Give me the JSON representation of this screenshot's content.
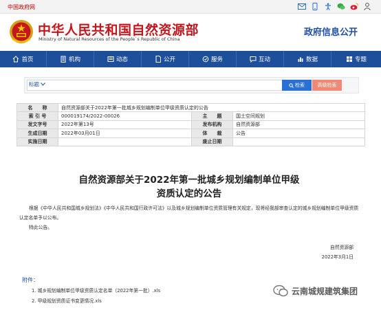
{
  "topbar": {
    "gov_link": "中国政府网",
    "icons": [
      "envelope-icon",
      "mobile-icon",
      "accessibility-icon",
      "wechat-icon",
      "weibo-icon",
      "user-icon"
    ]
  },
  "header": {
    "ministry_cn": "中华人民共和国自然资源部",
    "ministry_en": "Ministry of Natural Resources of the People`s Republic of China",
    "gov_info": "政府信息公开"
  },
  "nav": {
    "items": [
      {
        "label": "首页",
        "icon": "home-icon"
      },
      {
        "label": "机构",
        "icon": "building-icon"
      },
      {
        "label": "动态",
        "icon": "news-icon"
      },
      {
        "label": "公开",
        "icon": "document-icon"
      },
      {
        "label": "服务",
        "icon": "service-icon"
      },
      {
        "label": "互动",
        "icon": "chat-icon"
      },
      {
        "label": "数据",
        "icon": "chart-icon"
      },
      {
        "label": "专题",
        "icon": "topic-icon"
      }
    ]
  },
  "search": {
    "select_value": "标题",
    "search_label": "检索",
    "advanced_label": "高级检索"
  },
  "meta": {
    "rows": [
      {
        "label": "名　　称",
        "value": "自然资源部关于2022年第一批城乡规划编制单位甲级资质认定的公告"
      },
      {
        "label": "索 引 号",
        "value": "000019174/2022-00026",
        "label2": "主　　题",
        "value2": "国土空间规划"
      },
      {
        "label": "发文字号",
        "value": "2022年第13号",
        "label2": "发布机构",
        "value2": "自然资源部"
      },
      {
        "label": "生成日期",
        "value": "2022年03月01日",
        "label2": "体　　裁",
        "value2": "公告"
      },
      {
        "label": "实施日期",
        "value": "",
        "label2": "废止日期",
        "value2": ""
      }
    ]
  },
  "article": {
    "title_line1": "自然资源部关于2022年第一批城乡规划编制单位甲级",
    "title_line2": "资质认定的公告",
    "p1": "根据《中华人民共和国城乡规划法》《中华人民共和国行政许可法》以及城乡规划编制单位资质管理有关规定，现将经我部审查认定的城乡规划编制单位甲级资质认定名单予以公布。",
    "p2": "特此公告。",
    "sign_org": "自然资源部",
    "sign_date": "2022年3月1日",
    "attachments_label": "附件：",
    "attachments": [
      "1. 城乡规划编制单位甲级资质认定名单（2022年第一批）.xls",
      "2. 甲级规划资质证书变更情况.xls"
    ]
  },
  "watermark": {
    "text": "云南城规建筑集团"
  }
}
